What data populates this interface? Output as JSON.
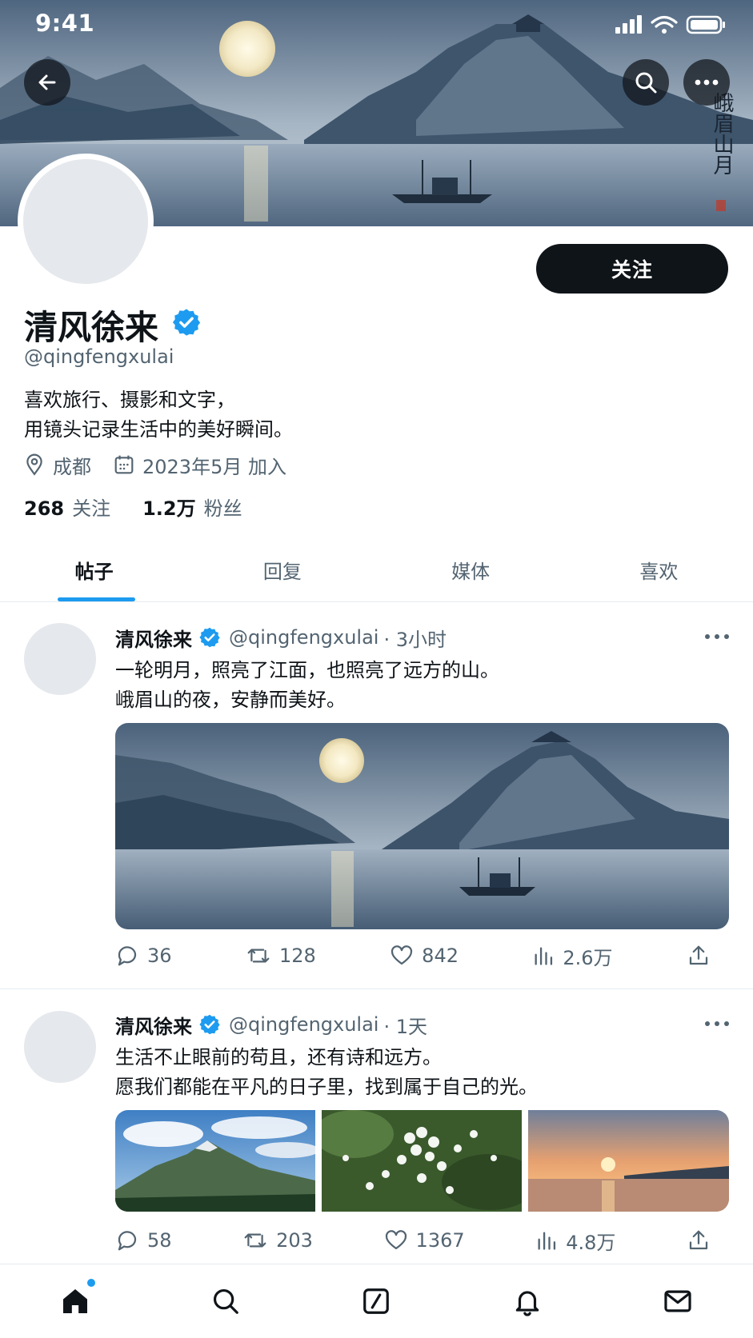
{
  "status_bar": {
    "time": "9:41"
  },
  "banner": {
    "calligraphy": "峨眉山月"
  },
  "profile": {
    "display_name": "清风徐来",
    "handle": "@qingfengxulai",
    "bio_line1": "喜欢旅行、摄影和文字，",
    "bio_line2": "用镜头记录生活中的美好瞬间。",
    "location": "成都",
    "joined": "2023年5月 加入",
    "following_count": "268",
    "following_label": "关注",
    "followers_count": "1.2万",
    "followers_label": "粉丝",
    "follow_button": "关注"
  },
  "tabs": [
    {
      "label": "帖子",
      "active": true
    },
    {
      "label": "回复",
      "active": false
    },
    {
      "label": "媒体",
      "active": false
    },
    {
      "label": "喜欢",
      "active": false
    }
  ],
  "posts": [
    {
      "author": "清风徐来",
      "handle": "@qingfengxulai",
      "time": "· 3小时",
      "text_line1": "一轮明月，照亮了江面，也照亮了远方的山。",
      "text_line2": "峨眉山的夜，安静而美好。",
      "replies": "36",
      "reposts": "128",
      "likes": "842",
      "views": "2.6万"
    },
    {
      "author": "清风徐来",
      "handle": "@qingfengxulai",
      "time": "· 1天",
      "text_line1": "生活不止眼前的苟且，还有诗和远方。",
      "text_line2": "愿我们都能在平凡的日子里，找到属于自己的光。",
      "replies": "58",
      "reposts": "203",
      "likes": "1367",
      "views": "4.8万"
    }
  ],
  "colors": {
    "accent": "#1d9bf0",
    "text": "#0f1419",
    "secondary": "#536471",
    "follow_bg": "#0f1419"
  },
  "icons": [
    "back-arrow-icon",
    "search-icon",
    "more-icon",
    "verified-icon",
    "location-icon",
    "calendar-icon",
    "reply-icon",
    "repost-icon",
    "like-icon",
    "views-icon",
    "share-icon",
    "home-icon",
    "search-nav-icon",
    "compose-icon",
    "notifications-icon",
    "messages-icon"
  ]
}
